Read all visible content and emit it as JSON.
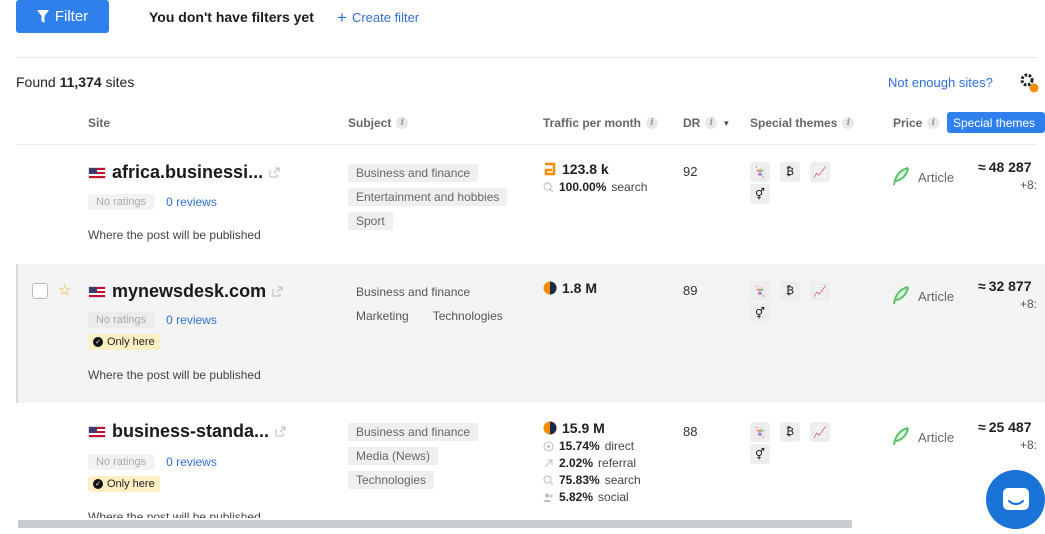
{
  "toolbar": {
    "filter_label": "Filter",
    "no_filters": "You don't have filters yet",
    "create_filter": "Create filter"
  },
  "summary": {
    "found_prefix": "Found",
    "found_count": "11,374",
    "found_suffix": "sites",
    "not_enough": "Not enough sites?"
  },
  "columns": {
    "site": "Site",
    "subject": "Subject",
    "traffic": "Traffic per month",
    "dr": "DR",
    "special_themes": "Special themes",
    "price": "Price",
    "special_badge": "Special themes"
  },
  "rows": [
    {
      "site": "africa.businessi...",
      "rating": "No ratings",
      "reviews": "0 reviews",
      "only_here": "",
      "where": "Where the post will be published",
      "subjects": [
        "Business and finance",
        "Entertainment and hobbies",
        "Sport"
      ],
      "traffic": "123.8 k",
      "traffic_lines": [
        {
          "value": "100.00%",
          "label": "search"
        }
      ],
      "dr": "92",
      "price_type": "Article",
      "count": "48 287",
      "count_sub": "+8:"
    },
    {
      "site": "mynewsdesk.com",
      "rating": "No ratings",
      "reviews": "0 reviews",
      "only_here": "Only here",
      "where": "Where the post will be published",
      "subjects": [
        "Business and finance",
        "Marketing",
        "Technologies"
      ],
      "traffic": "1.8 M",
      "traffic_lines": [],
      "dr": "89",
      "price_type": "Article",
      "count": "32 877",
      "count_sub": "+8:"
    },
    {
      "site": "business-standa...",
      "rating": "No ratings",
      "reviews": "0 reviews",
      "only_here": "Only here",
      "where": "Where the post will be published",
      "subjects": [
        "Business and finance",
        "Media (News)",
        "Technologies"
      ],
      "traffic": "15.9 M",
      "traffic_lines": [
        {
          "value": "15.74%",
          "label": "direct"
        },
        {
          "value": "2.02%",
          "label": "referral"
        },
        {
          "value": "75.83%",
          "label": "search"
        },
        {
          "value": "5.82%",
          "label": "social"
        }
      ],
      "dr": "88",
      "price_type": "Article",
      "count": "25 487",
      "count_sub": "+8:"
    }
  ],
  "colors": {
    "primary": "#2f80ed",
    "link": "#2f6fd6",
    "only_here_bg": "#fdefc4",
    "feather": "#5cbf6a",
    "ahrefs_orange": "#f28c00"
  },
  "icons": [
    "filter-icon",
    "plus-icon",
    "gear-icon",
    "external-link-icon",
    "flag-us-icon",
    "star-icon",
    "feather-icon",
    "chat-icon"
  ]
}
